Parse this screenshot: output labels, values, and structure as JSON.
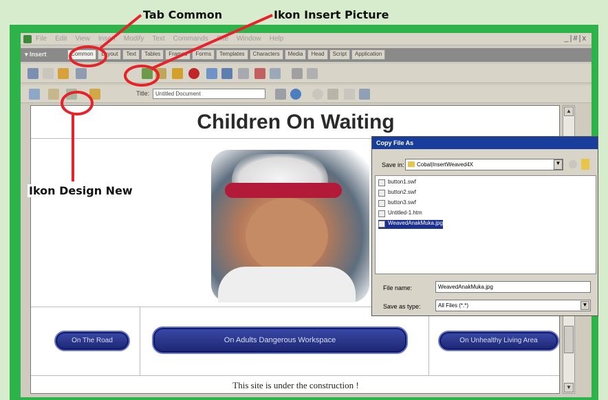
{
  "annotations": {
    "tab_common": "Tab Common",
    "insert_picture": "Ikon Insert Picture",
    "design_new": "Ikon Design New"
  },
  "colors": {
    "frame": "#2db34a",
    "callout_red": "#e5232b",
    "dialog_title": "#183d9a",
    "button_blue": "#1c2570"
  },
  "menubar": {
    "items": [
      "File",
      "Edit",
      "View",
      "Insert",
      "Modify",
      "Text",
      "Commands",
      "Site",
      "Window",
      "Help"
    ],
    "window_buttons": "_|#|x"
  },
  "insertbar": {
    "label": "▾ Insert",
    "tabs": [
      "Common",
      "Layout",
      "Text",
      "Tables",
      "Frames",
      "Forms",
      "Templates",
      "Characters",
      "Media",
      "Head",
      "Script",
      "Application"
    ]
  },
  "icons": [
    "hyperlink-icon",
    "email-icon",
    "anchor-icon",
    "table-icon",
    "layer-icon",
    "image-icon",
    "image-placeholder-icon",
    "fireworks-icon",
    "flash-icon",
    "rollover-icon",
    "navbar-icon",
    "rule-icon",
    "date-icon",
    "tabular-data-icon",
    "comment-icon",
    "tag-chooser-icon"
  ],
  "docbar": {
    "title_label": "Title:",
    "title_value": "Untitled Document"
  },
  "page": {
    "heading": "Children On Waiting",
    "buttons": [
      "On The Road",
      "On Adults Dangerous Workspace",
      "On Unhealthy Living Area"
    ],
    "footer": "This site is under the construction !"
  },
  "dialog": {
    "title": "Copy File As",
    "save_in_label": "Save in:",
    "save_in_value": "Cobal|InsertWeaved4X",
    "files": [
      "button1.swf",
      "button2.swf",
      "button3.swf",
      "Untitled-1.htm",
      "WeavedAnakMuka.jpg"
    ],
    "selected_file": "WeavedAnakMuka.jpg",
    "file_name_label": "File name:",
    "file_name_value": "WeavedAnakMuka.jpg",
    "save_type_label": "Save as type:",
    "save_type_value": "All Files (*.*)"
  }
}
